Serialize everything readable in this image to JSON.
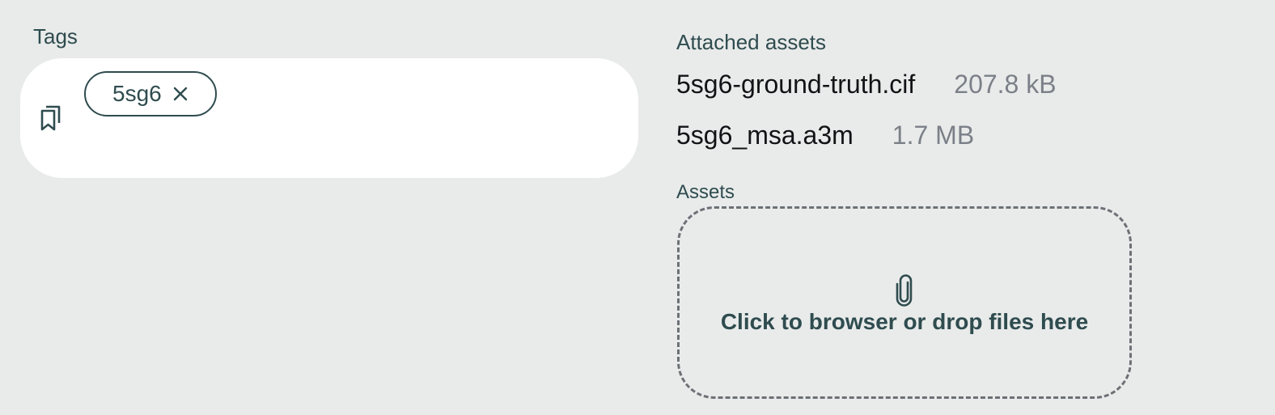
{
  "tags": {
    "label": "Tags",
    "icon": "bookmarks-icon",
    "items": [
      {
        "label": "5sg6",
        "remove_icon": "close-icon"
      }
    ]
  },
  "attached_assets": {
    "title": "Attached assets",
    "files": [
      {
        "name": "5sg6-ground-truth.cif",
        "size": "207.8 kB"
      },
      {
        "name": "5sg6_msa.a3m",
        "size": "1.7 MB"
      }
    ]
  },
  "assets": {
    "label": "Assets",
    "icon": "paperclip-icon",
    "dropzone_text": "Click to browser or drop files here"
  },
  "colors": {
    "background": "#e9ebea",
    "text_primary": "#2f4c4f",
    "file_name": "#111416",
    "file_size": "#7b8088",
    "dropzone_border": "#6c7176"
  }
}
